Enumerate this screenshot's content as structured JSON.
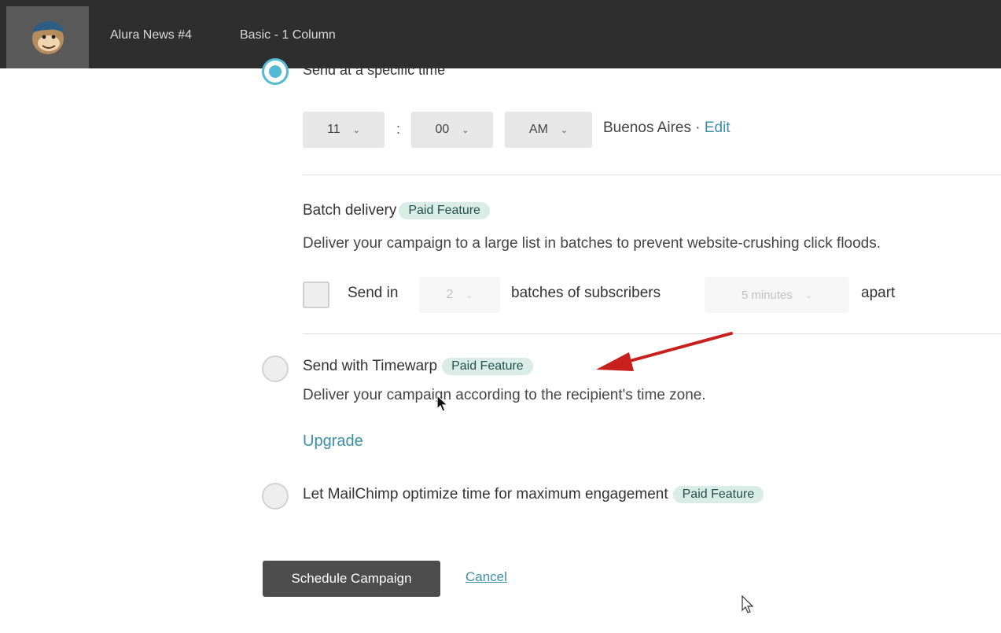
{
  "header": {
    "campaign_name": "Alura News #4",
    "template_name": "Basic - 1 Column",
    "logo_icon": "mailchimp-logo"
  },
  "schedule": {
    "specific_time_label": "Send at a specific time",
    "hour": "11",
    "minute": "00",
    "ampm": "AM",
    "colon": ":",
    "timezone": "Buenos Aires · ",
    "edit_label": "Edit"
  },
  "batch": {
    "title": "Batch delivery",
    "badge": "Paid Feature",
    "description": "Deliver your campaign to a large list in batches to prevent website-crushing click floods.",
    "send_in_label": "Send in",
    "batch_count": "2",
    "batches_label": "batches of subscribers",
    "interval": "5 minutes",
    "apart_label": "apart"
  },
  "timewarp": {
    "title": "Send with Timewarp",
    "badge": "Paid Feature",
    "description": "Deliver your campaign according to the recipient's time zone.",
    "upgrade_label": "Upgrade"
  },
  "optimize": {
    "title": "Let MailChimp optimize time for maximum engagement",
    "badge": "Paid Feature"
  },
  "actions": {
    "schedule_label": "Schedule Campaign",
    "cancel_label": "Cancel"
  },
  "colors": {
    "accent": "#52bad5",
    "link": "#3c8fa6",
    "badge_bg": "#d9ece5",
    "annotation_arrow": "#c8201d"
  }
}
